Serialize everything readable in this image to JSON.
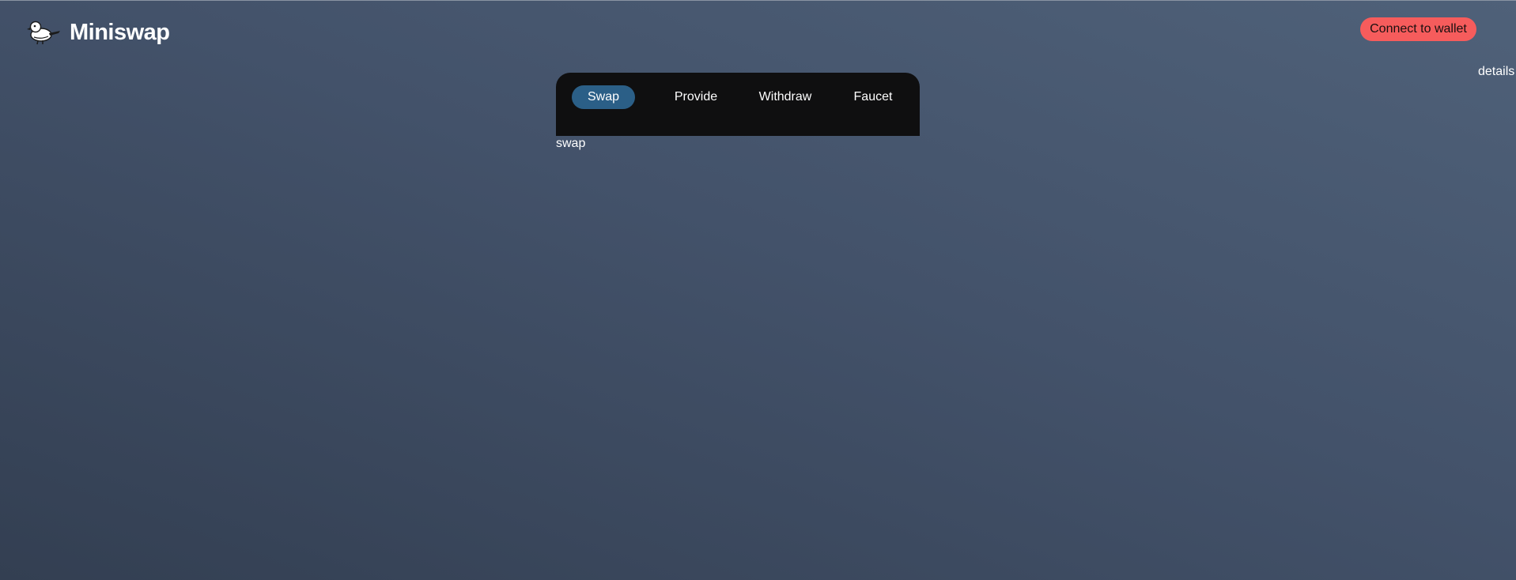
{
  "header": {
    "brand_name": "Miniswap",
    "logo_icon": "duck-logo-icon",
    "connect_label": "Connect to wallet",
    "connect_color": "#f65c5c",
    "details_label": "details"
  },
  "tabs": [
    {
      "label": "Swap",
      "active": true
    },
    {
      "label": "Provide",
      "active": false
    },
    {
      "label": "Withdraw",
      "active": false
    },
    {
      "label": "Faucet",
      "active": false
    }
  ],
  "main": {
    "content_label": "swap"
  },
  "colors": {
    "active_tab": "#2b5f87",
    "panel_bg": "#0f0f10"
  }
}
